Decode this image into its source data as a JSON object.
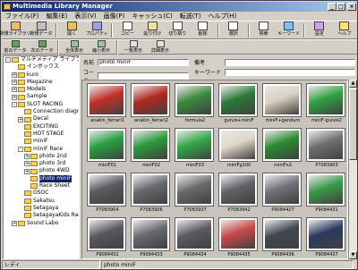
{
  "window": {
    "title": "Multimedia Library Manager",
    "controls": [
      "_",
      "□",
      "×"
    ]
  },
  "menu": [
    "ファイル(F)",
    "編集(E)",
    "表示(V)",
    "画像(P)",
    "キャッシュ(C)",
    "転送(T)",
    "ヘルプ(H)"
  ],
  "toolbar1": [
    {
      "label": "新規ライブラリ",
      "icon": "new-library-icon",
      "color": "#e8c060"
    },
    {
      "label": "新規データ",
      "icon": "new-data-icon",
      "color": "#c0c0c0"
    },
    {
      "label": "開く",
      "icon": "open-icon",
      "color": "#e8c060"
    },
    {
      "label": "プロパティ",
      "icon": "properties-icon",
      "color": "#a0a0e0"
    },
    {
      "label": "コピー",
      "icon": "copy-icon",
      "color": "#ffffff"
    },
    {
      "label": "貼り付け",
      "icon": "paste-icon",
      "color": "#f0e0a0"
    },
    {
      "label": "切り取り",
      "icon": "cut-icon",
      "color": "#ffffff"
    },
    {
      "label": "削除",
      "icon": "delete-icon",
      "color": "#ffffff"
    },
    {
      "label": "選択",
      "icon": "select-icon",
      "color": "#ffffff"
    },
    {
      "label": "検索",
      "icon": "search-icon",
      "color": "#ffffff"
    },
    {
      "label": "キーワード",
      "icon": "keyword-icon",
      "color": "#80c0ff"
    },
    {
      "label": "設定",
      "icon": "settings-icon",
      "color": "#d0a0f0"
    },
    {
      "label": "ヘルプ",
      "icon": "help-icon",
      "color": "#ffe070"
    }
  ],
  "toolbar2": [
    {
      "label": "前のデータ",
      "icon": "prev-data-icon",
      "color": "#60a060"
    },
    {
      "label": "次のデータ",
      "icon": "next-data-icon",
      "color": "#60a060"
    },
    {
      "label": "全体表示",
      "icon": "full-view-icon",
      "color": "#a0c0a0"
    },
    {
      "label": "縮小表示",
      "icon": "shrink-view-icon",
      "color": "#a0c0a0"
    },
    {
      "label": "一覧表示",
      "icon": "list-view-icon",
      "color": "#e0e0e0"
    },
    {
      "label": "詳細表示",
      "icon": "detail-view-icon",
      "color": "#e0e0e0"
    }
  ],
  "tree": [
    {
      "label": "マルチメディア ライブラリ",
      "level": 0,
      "exp": "-"
    },
    {
      "label": "インボックス",
      "level": 1,
      "exp": ""
    },
    {
      "label": "kuro",
      "level": 1,
      "exp": "+"
    },
    {
      "label": "Magazine",
      "level": 1,
      "exp": "+"
    },
    {
      "label": "Models",
      "level": 1,
      "exp": "+"
    },
    {
      "label": "Sample",
      "level": 1,
      "exp": "+"
    },
    {
      "label": "SLOT RACING",
      "level": 1,
      "exp": "-"
    },
    {
      "label": "Connection diagram",
      "level": 2,
      "exp": ""
    },
    {
      "label": "Decal",
      "level": 2,
      "exp": "+"
    },
    {
      "label": "EXCITING",
      "level": 2,
      "exp": ""
    },
    {
      "label": "HOT STAGE",
      "level": 2,
      "exp": ""
    },
    {
      "label": "miniF",
      "level": 2,
      "exp": ""
    },
    {
      "label": "miniF Race",
      "level": 2,
      "exp": "-"
    },
    {
      "label": "photo 2nd",
      "level": 3,
      "exp": "+"
    },
    {
      "label": "photo 3rd",
      "level": 3,
      "exp": "+"
    },
    {
      "label": "photo 4WD",
      "level": 3,
      "exp": "+"
    },
    {
      "label": "photo miniF",
      "level": 3,
      "exp": "",
      "selected": true
    },
    {
      "label": "Race Sheet",
      "level": 3,
      "exp": ""
    },
    {
      "label": "OSOC",
      "level": 2,
      "exp": ""
    },
    {
      "label": "Sakatsu",
      "level": 2,
      "exp": ""
    },
    {
      "label": "Setagaya",
      "level": 2,
      "exp": ""
    },
    {
      "label": "SetagayaKids Race",
      "level": 2,
      "exp": ""
    },
    {
      "label": "Sound Labo",
      "level": 1,
      "exp": "+"
    }
  ],
  "fields": {
    "name_label": "名前",
    "name_value": "photo miniF",
    "code_label": "コード",
    "code_value": "",
    "note_label": "備考",
    "note_value": "",
    "keyword_label": "キーワード",
    "keyword_value": ""
  },
  "thumbnails": [
    {
      "caption": "anakin_ferrari1",
      "color": "#c03028"
    },
    {
      "caption": "anakin_ferrari2",
      "color": "#b02820"
    },
    {
      "caption": "formula2",
      "color": "#3a8a40"
    },
    {
      "caption": "gunze+miniF",
      "color": "#2a7a38"
    },
    {
      "caption": "miniF+gandum",
      "color": "#d8d0c0"
    },
    {
      "caption": "miniF-gunze2",
      "color": "#30a040"
    },
    {
      "caption": "miniF01",
      "color": "#28a040"
    },
    {
      "caption": "miniF02",
      "color": "#2a9a3a"
    },
    {
      "caption": "miniF03",
      "color": "#30a848"
    },
    {
      "caption": "miniFg100",
      "color": "#e0d8c8"
    },
    {
      "caption": "miniFx2",
      "color": "#2a8a30"
    },
    {
      "caption": "P7083903",
      "color": "#707070"
    },
    {
      "caption": "P7083904",
      "color": "#5a5a60"
    },
    {
      "caption": "P7083906",
      "color": "#686870"
    },
    {
      "caption": "P7083937",
      "color": "#6a6a6a"
    },
    {
      "caption": "P7083942",
      "color": "#626268"
    },
    {
      "caption": "P9084427",
      "color": "#707078"
    },
    {
      "caption": "P9084431",
      "color": "#3a9a48"
    },
    {
      "caption": "P9084432",
      "color": "#58585e"
    },
    {
      "caption": "P9084433",
      "color": "#6a6a70"
    },
    {
      "caption": "P9084434",
      "color": "#5a5a60"
    },
    {
      "caption": "P9084435",
      "color": "#c84848"
    },
    {
      "caption": "P9084436",
      "color": "#404850"
    },
    {
      "caption": "P9084437",
      "color": "#2a3a60"
    }
  ],
  "status": {
    "left": "レディ",
    "mid": "photo miniF"
  }
}
